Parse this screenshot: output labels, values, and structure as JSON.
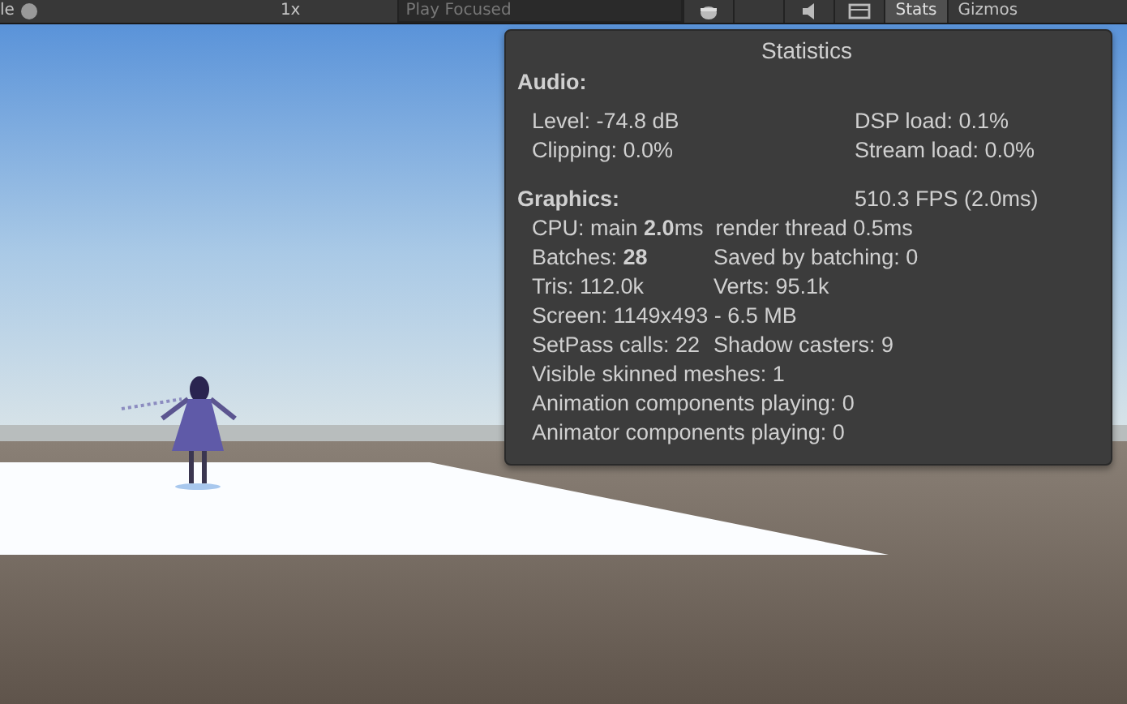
{
  "toolbar": {
    "items": [
      {
        "kind": "label",
        "text": "le"
      },
      {
        "kind": "slider-knob"
      },
      {
        "kind": "label",
        "text": "1x"
      },
      {
        "kind": "dropdown",
        "text": "Play Focused"
      },
      {
        "kind": "mute-toggle"
      },
      {
        "kind": "spacer-button"
      },
      {
        "kind": "audio-toggle"
      },
      {
        "kind": "display-toggle"
      },
      {
        "kind": "toggle",
        "text": "Stats",
        "selected": true
      },
      {
        "kind": "toggle",
        "text": "Gizmos",
        "selected": false
      }
    ]
  },
  "statistics": {
    "title": "Statistics",
    "sections": [
      {
        "heading": "Audio:",
        "rows": [
          [
            "Level: -74.8 dB",
            "DSP load: 0.1%"
          ],
          [
            "Clipping: 0.0%",
            "Stream load: 0.0%"
          ]
        ]
      },
      {
        "heading": "Graphics:",
        "heading_right": "510.3 FPS (2.0ms)",
        "rows": [
          [
            "CPU: main **2.0**ms  render thread 0.5ms"
          ],
          [
            "Batches: **28**",
            "Saved by batching: 0"
          ],
          [
            "Tris: 112.0k",
            "Verts: 95.1k"
          ],
          [
            "Screen: 1149x493 - 6.5 MB"
          ],
          [
            "SetPass calls: 22",
            "Shadow casters: 9"
          ],
          [
            "Visible skinned meshes: 1"
          ],
          [
            "Animation components playing: 0"
          ],
          [
            "Animator components playing: 0"
          ]
        ]
      }
    ]
  }
}
